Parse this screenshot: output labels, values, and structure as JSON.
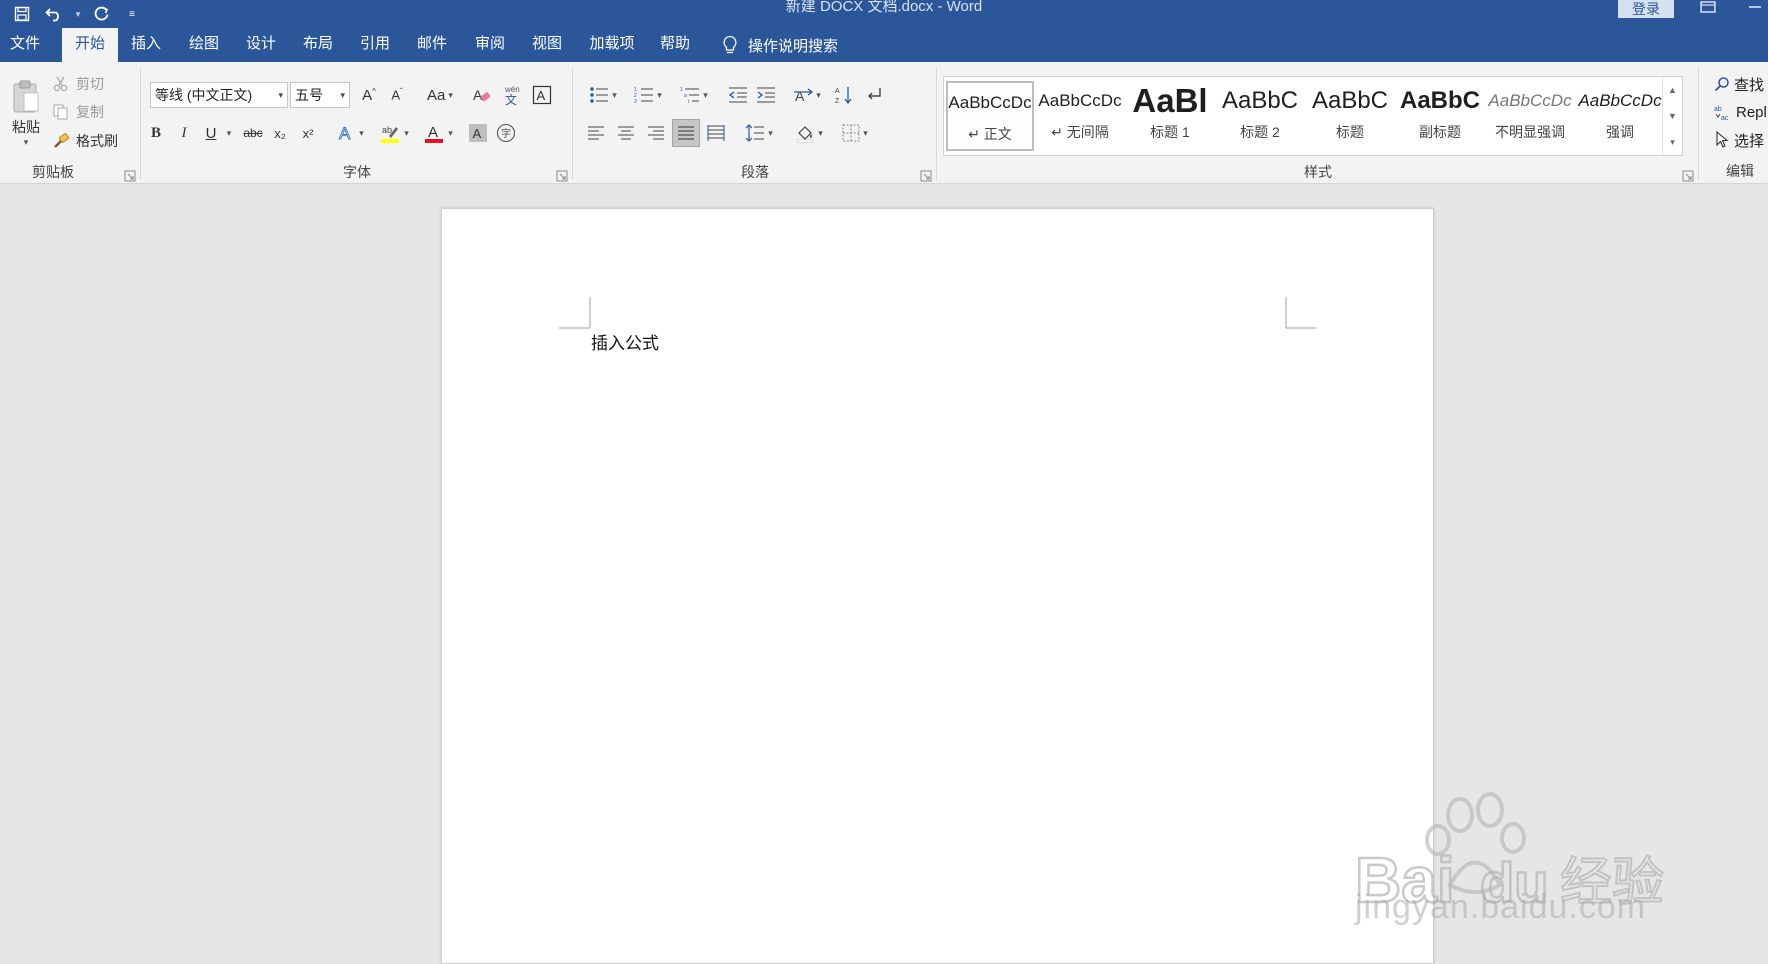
{
  "titlebar": {
    "doc_title": "新建 DOCX 文档.docx  -  Word",
    "login": "登录"
  },
  "tabs": [
    "文件",
    "开始",
    "插入",
    "绘图",
    "设计",
    "布局",
    "引用",
    "邮件",
    "审阅",
    "视图",
    "加载项",
    "帮助"
  ],
  "active_tab": "开始",
  "tellme": "操作说明搜索",
  "clipboard": {
    "label": "剪贴板",
    "paste": "粘贴",
    "cut": "剪切",
    "copy": "复制",
    "format_painter": "格式刷"
  },
  "font": {
    "label": "字体",
    "font_name": "等线 (中文正文)",
    "font_size": "五号",
    "change_case": "Aa",
    "bold": "B",
    "italic": "I",
    "underline": "U",
    "strike": "abc",
    "subscript": "x₂",
    "superscript": "x²",
    "font_color": "#e81123",
    "highlight_color": "#ffff00"
  },
  "paragraph": {
    "label": "段落"
  },
  "styles": {
    "label": "样式",
    "items": [
      {
        "sample": "AaBbCcDc",
        "name": "↵ 正文"
      },
      {
        "sample": "AaBbCcDc",
        "name": "↵ 无间隔"
      },
      {
        "sample": "AaBl",
        "name": "标题 1"
      },
      {
        "sample": "AaBbC",
        "name": "标题 2"
      },
      {
        "sample": "AaBbC",
        "name": "标题"
      },
      {
        "sample": "AaBbC",
        "name": "副标题"
      },
      {
        "sample": "AaBbCcDc",
        "name": "不明显强调"
      },
      {
        "sample": "AaBbCcDc",
        "name": "强调"
      }
    ]
  },
  "editing": {
    "label": "编辑",
    "find": "查找",
    "replace": "Repl",
    "select": "选择"
  },
  "document": {
    "text": "插入公式"
  },
  "watermark": {
    "brand": "Bai",
    "brand2": "du",
    "brand_cn": "经验",
    "url": "jingyan.baidu.com"
  },
  "colors": {
    "accent": "#2b579a",
    "ribbon": "#f3f3f3"
  }
}
